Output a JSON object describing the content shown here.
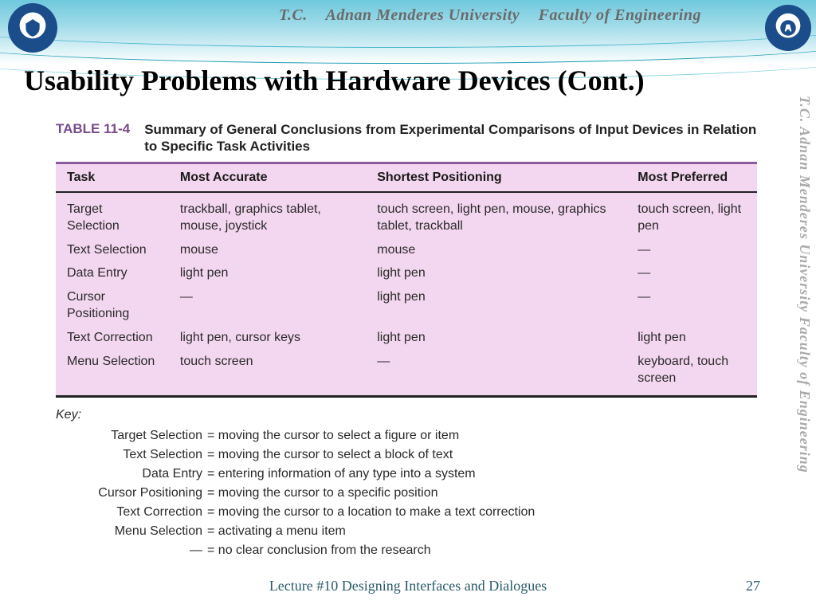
{
  "banner": {
    "tc": "T.C.",
    "university": "Adnan Menderes University",
    "faculty": "Faculty of Engineering"
  },
  "side_text": "T.C.   Adnan Menderes University   Faculty of Engineering",
  "slide": {
    "title": "Usability Problems with Hardware Devices (Cont.)"
  },
  "table": {
    "number": "TABLE 11-4",
    "caption": "Summary of General Conclusions from Experimental Comparisons of Input Devices in Relation to Specific Task Activities",
    "headers": [
      "Task",
      "Most Accurate",
      "Shortest Positioning",
      "Most Preferred"
    ],
    "rows": [
      {
        "task": "Target Selection",
        "accurate": "trackball, graphics tablet, mouse, joystick",
        "shortest": "touch screen, light pen, mouse, graphics tablet, trackball",
        "preferred": "touch screen, light pen"
      },
      {
        "task": "Text Selection",
        "accurate": "mouse",
        "shortest": "mouse",
        "preferred": "—"
      },
      {
        "task": "Data Entry",
        "accurate": "light pen",
        "shortest": "light pen",
        "preferred": "—"
      },
      {
        "task": "Cursor Positioning",
        "accurate": "—",
        "shortest": "light pen",
        "preferred": "—"
      },
      {
        "task": "Text Correction",
        "accurate": "light pen, cursor keys",
        "shortest": "light pen",
        "preferred": "light pen"
      },
      {
        "task": "Menu Selection",
        "accurate": "touch screen",
        "shortest": "—",
        "preferred": "keyboard, touch screen"
      }
    ]
  },
  "key": {
    "title": "Key:",
    "items": [
      {
        "term": "Target Selection",
        "def": "moving the cursor to select a figure or item"
      },
      {
        "term": "Text Selection",
        "def": "moving the cursor to select a block of text"
      },
      {
        "term": "Data Entry",
        "def": "entering information of any type into a system"
      },
      {
        "term": "Cursor Positioning",
        "def": "moving the cursor to a specific position"
      },
      {
        "term": "Text Correction",
        "def": "moving the cursor to a location to make a text correction"
      },
      {
        "term": "Menu Selection",
        "def": "activating a menu item"
      },
      {
        "term": "—",
        "def": "no clear conclusion from the research"
      }
    ]
  },
  "footer": {
    "text": "Lecture #10 Designing Interfaces and Dialogues",
    "page": "27"
  }
}
